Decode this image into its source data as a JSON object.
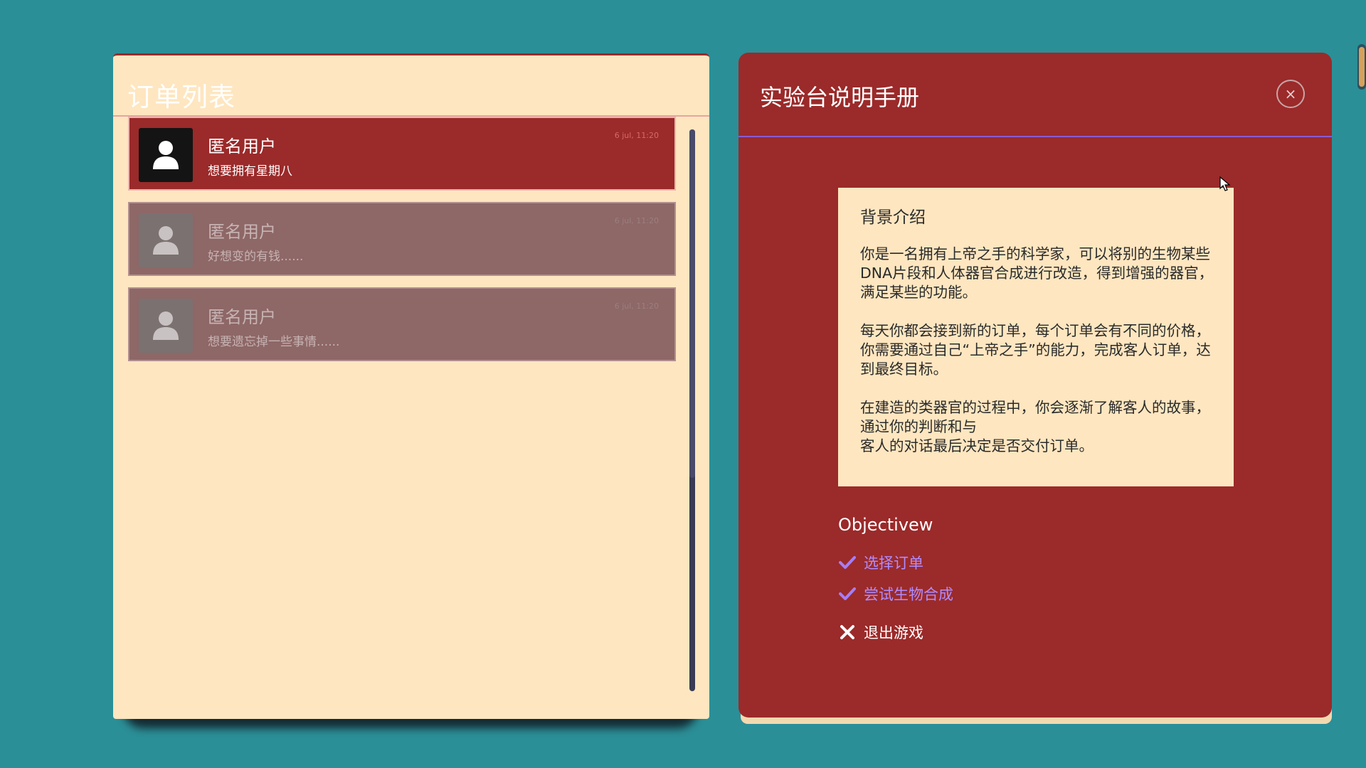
{
  "orders": {
    "title": "订单列表",
    "items": [
      {
        "name": "匿名用户",
        "message": "想要拥有星期八",
        "time": "6 jul, 11:20",
        "active": true
      },
      {
        "name": "匿名用户",
        "message": "好想变的有钱......",
        "time": "6 jul, 11:20",
        "active": false
      },
      {
        "name": "匿名用户",
        "message": "想要遗忘掉一些事情......",
        "time": "6 jul, 11:20",
        "active": false
      }
    ]
  },
  "manual": {
    "title": "实验台说明手册",
    "close_label": "×",
    "intro": {
      "heading": "背景介绍",
      "paragraphs": [
        "你是一名拥有上帝之手的科学家，可以将别的生物某些DNA片段和人体器官合成进行改造，得到增强的器官，满足某些的功能。",
        "每天你都会接到新的订单，每个订单会有不同的价格，你需要通过自己“上帝之手”的能力，完成客人订单，达到最终目标。",
        "在建造的类器官的过程中，你会逐渐了解客人的故事，通过你的判断和与\n客人的对话最后决定是否交付订单。"
      ]
    },
    "objectives_heading": "Objectivew",
    "objectives": [
      {
        "label": "选择订单",
        "status": "done"
      },
      {
        "label": "尝试生物合成",
        "status": "done"
      },
      {
        "label": "退出游戏",
        "status": "exit"
      }
    ]
  },
  "colors": {
    "background": "#2b8f97",
    "panel_cream": "#fee6c0",
    "panel_red": "#9b2a2a",
    "accent_purple": "#b08cff"
  }
}
